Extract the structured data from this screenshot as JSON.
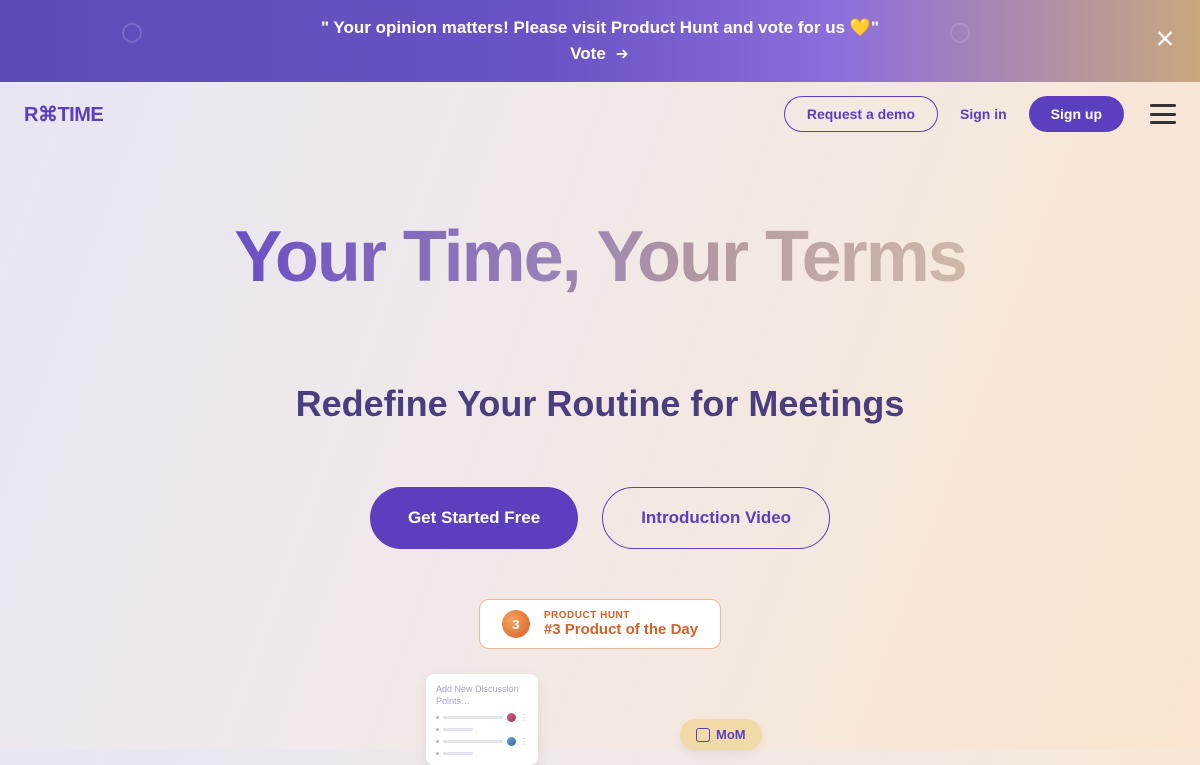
{
  "announce": {
    "text": "\" Your opinion matters! Please visit Product Hunt and vote for us 💛\"",
    "vote_label": "Vote"
  },
  "header": {
    "logo_text": "R⌘TIME",
    "request_demo": "Request a demo",
    "sign_in": "Sign in",
    "sign_up": "Sign up"
  },
  "hero": {
    "title": "Your Time, Your Terms",
    "subtitle": "Redefine Your Routine for Meetings",
    "cta_primary": "Get Started Free",
    "cta_secondary": "Introduction Video"
  },
  "ph": {
    "rank": "3",
    "label": "PRODUCT HUNT",
    "title": "#3 Product of the Day"
  },
  "preview": {
    "discuss_title": "Add New Discussion Points…",
    "mom_label": "MoM"
  }
}
